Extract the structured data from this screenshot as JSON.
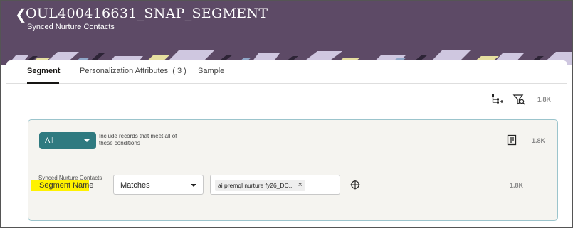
{
  "header": {
    "back_icon": "chevron-left-icon",
    "title": "OUL400416631_SNAP_SEGMENT",
    "subtitle": "Synced Nurture Contacts",
    "background_color": "#5d4a66"
  },
  "tabs": [
    {
      "label": "Segment",
      "active": true
    },
    {
      "label": "Personalization Attributes",
      "count": "( 3 )",
      "active": false
    },
    {
      "label": "Sample",
      "active": false
    }
  ],
  "toolbar": {
    "hierarchy_icon": "hierarchy-add-icon",
    "filter_icon": "filter-search-icon",
    "count": "1.8K"
  },
  "rule_group": {
    "operator": "All",
    "description": "Include records that meet all of these conditions",
    "notes_icon": "document-icon",
    "count": "1.8K",
    "accent_color": "#2f7a80"
  },
  "condition": {
    "source_label": "Synced Nurture Contacts",
    "field_label": "Segment Name",
    "operator": "Matches",
    "value_chip": "ai premql nurture fy26_DC...",
    "remove_icon": "close-icon",
    "target_icon": "crosshair-icon",
    "count": "1.8K"
  }
}
